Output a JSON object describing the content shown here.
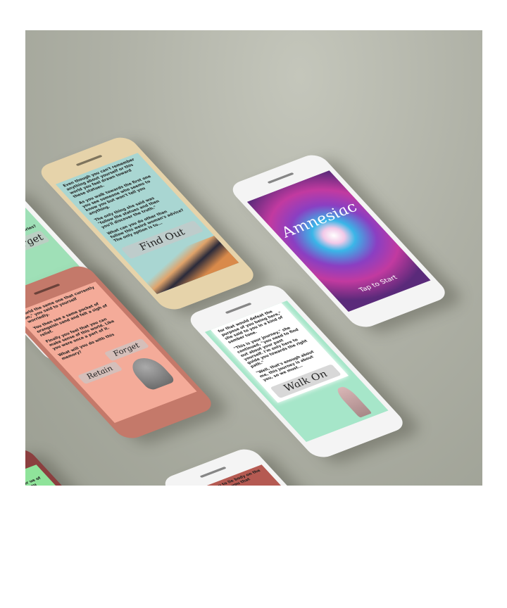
{
  "phones": {
    "green_left": {
      "button": "Forget",
      "text": "memories?"
    },
    "gold": {
      "paragraphs": [
        "Even though you can't remember anything about yourself or this world you feel drawn toward these statues.",
        "As you walk towards the first one you see someone who seems to know you but won't tell you anything.",
        "The only thing she said was \"follow the statues and then you'll discover the truth.\"",
        "What can you do other than follow this weird woman's advice? The only option is to..."
      ],
      "button": "Find Out"
    },
    "amnesiac": {
      "title": "Amnesiac",
      "cta": "Tap to Start"
    },
    "salmon": {
      "paragraphs": [
        "world the same one that currently on,\" you said to yourself worriedly.",
        "You then see a same pocket of orangeish sand and felt a sigh of relief.",
        "Finally you feel that you can make sense of this world. Like you were once a part of it.",
        "What will you do with this memory?"
      ],
      "buttons": [
        "Forget",
        "Retain"
      ]
    },
    "walk_on": {
      "paragraphs": [
        "for that would defeat the purpose of you being here,\" she said to you in a kind of somber tone.",
        "\"This is your journey,\" she continued, \"you need to find out about your past yourself. I'm only here to guide you towards the right path.\"",
        "\"Well, that's enough about me, this journey is about you, so we must..."
      ],
      "button": "Walk On"
    },
    "bottom_green": {
      "text": "our ue of d you"
    },
    "bottom_red": {
      "text": "me, leaving you to lie body on the ground yourself as you that"
    }
  }
}
